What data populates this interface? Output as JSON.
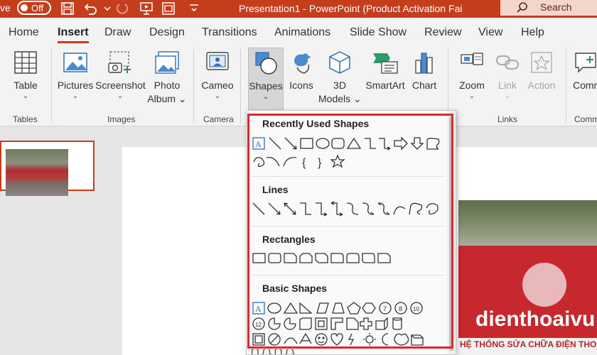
{
  "titlebar": {
    "autosave_label": "ve",
    "autosave_state": "Off",
    "document_title": "Presentation1  -  PowerPoint (Product Activation Fai",
    "search_label": "Search"
  },
  "tabs": [
    "Home",
    "Insert",
    "Draw",
    "Design",
    "Transitions",
    "Animations",
    "Slide Show",
    "Review",
    "View",
    "Help"
  ],
  "active_tab": "Insert",
  "ribbon": {
    "table": "Table",
    "pictures": "Pictures",
    "screenshot": "Screenshot",
    "photo_album_1": "Photo",
    "photo_album_2": "Album",
    "cameo": "Cameo",
    "shapes": "Shapes",
    "icons": "Icons",
    "models_1": "3D",
    "models_2": "Models",
    "smartart": "SmartArt",
    "chart": "Chart",
    "zoom": "Zoom",
    "link": "Link",
    "action": "Action",
    "comment": "Comm",
    "groups": {
      "tables": "Tables",
      "images": "Images",
      "camera": "Camera",
      "links": "Links",
      "comments": "Comm"
    }
  },
  "shapes_menu": {
    "recent": "Recently Used Shapes",
    "lines": "Lines",
    "rectangles": "Rectangles",
    "basic": "Basic Shapes"
  },
  "slide": {
    "brand_text": "dienthoaivu",
    "strip_text": "HỆ THỐNG SỬA CHỮA ĐIỆN THOẠI"
  }
}
